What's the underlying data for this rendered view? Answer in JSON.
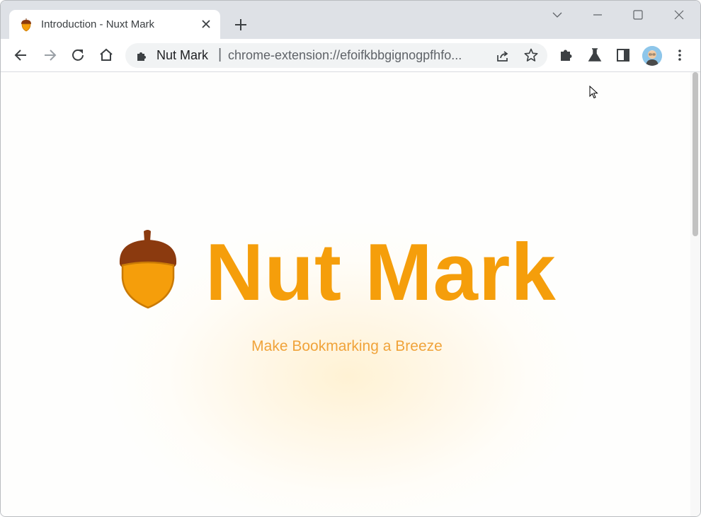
{
  "browser": {
    "tab": {
      "title": "Introduction - Nuxt Mark",
      "favicon": "acorn-icon"
    },
    "omnibox": {
      "site_name": "Nut Mark",
      "separator": "|",
      "url": "chrome-extension://efoifkbbgignogpfhfo..."
    },
    "icons": [
      "back-icon",
      "forward-icon",
      "reload-icon",
      "home-icon",
      "extension-icon",
      "share-icon",
      "star-icon",
      "puzzle-icon",
      "labs-icon",
      "side-panel-icon",
      "avatar",
      "more-menu-icon"
    ]
  },
  "page": {
    "title": "Nut Mark",
    "subtitle": "Make Bookmarking a Breeze",
    "colors": {
      "accent": "#f59e0b",
      "acorn_cap": "#8b3a0f",
      "acorn_body": "#f59e0b"
    }
  }
}
